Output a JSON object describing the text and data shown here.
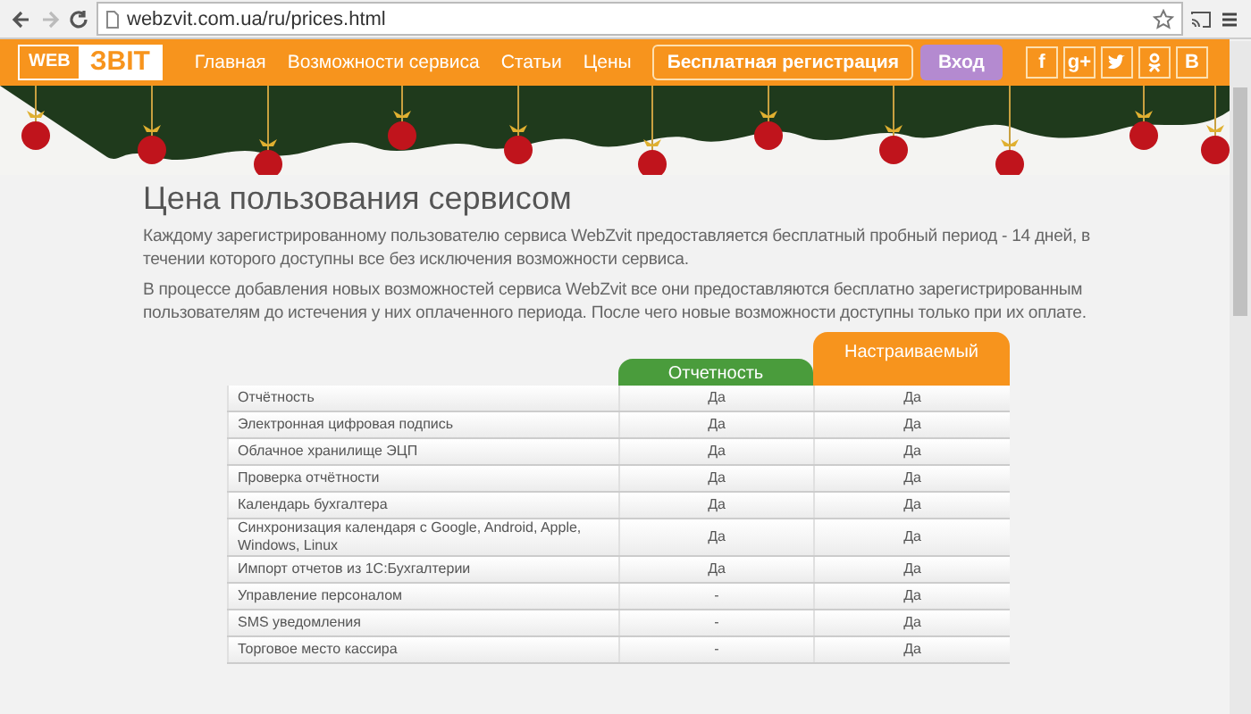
{
  "browser": {
    "url": "webzvit.com.ua/ru/prices.html"
  },
  "header": {
    "logo": [
      "WEB",
      "ЗВІТ"
    ],
    "nav": [
      "Главная",
      "Возможности сервиса",
      "Статьи",
      "Цены"
    ],
    "register_button": "Бесплатная регистрация",
    "login_button": "Вход",
    "social": [
      {
        "kind": "text",
        "label": "f"
      },
      {
        "kind": "text",
        "label": "g+"
      },
      {
        "kind": "twitter"
      },
      {
        "kind": "ok"
      },
      {
        "kind": "text",
        "label": "В"
      }
    ]
  },
  "title": "Цена пользования сервисом",
  "paragraphs": [
    "Каждому зарегистрированному пользователю сервиса WebZvit предоставляется бесплатный пробный период - 14 дней, в течении которого доступны все без исключения возможности сервиса.",
    "В процессе добавления новых возможностей сервиса WebZvit все они предоставляются бесплатно зарегистрированным пользователям до истечения у них оплаченного периода. После чего новые возможности доступны только при их оплате."
  ],
  "table": {
    "columns": [
      {
        "label": "Отчетность",
        "color": "#4a9c3c"
      },
      {
        "label": "Настраиваемый",
        "color": "#f7941d"
      }
    ],
    "rows": [
      {
        "feature": "Отчётность",
        "values": [
          "Да",
          "Да"
        ]
      },
      {
        "feature": "Электронная цифровая подпись",
        "values": [
          "Да",
          "Да"
        ]
      },
      {
        "feature": "Облачное хранилище ЭЦП",
        "values": [
          "Да",
          "Да"
        ]
      },
      {
        "feature": "Проверка отчётности",
        "values": [
          "Да",
          "Да"
        ]
      },
      {
        "feature": "Календарь бухгалтера",
        "values": [
          "Да",
          "Да"
        ]
      },
      {
        "feature": "Синхронизация календаря с Google, Android, Apple, Windows, Linux",
        "values": [
          "Да",
          "Да"
        ]
      },
      {
        "feature": "Импорт отчетов из 1С:Бухгалтерии",
        "values": [
          "Да",
          "Да"
        ]
      },
      {
        "feature": "Управление персоналом",
        "values": [
          "-",
          "Да"
        ]
      },
      {
        "feature": "SMS уведомления",
        "values": [
          "-",
          "Да"
        ]
      },
      {
        "feature": "Торговое место кассира",
        "values": [
          "-",
          "Да"
        ]
      }
    ]
  }
}
